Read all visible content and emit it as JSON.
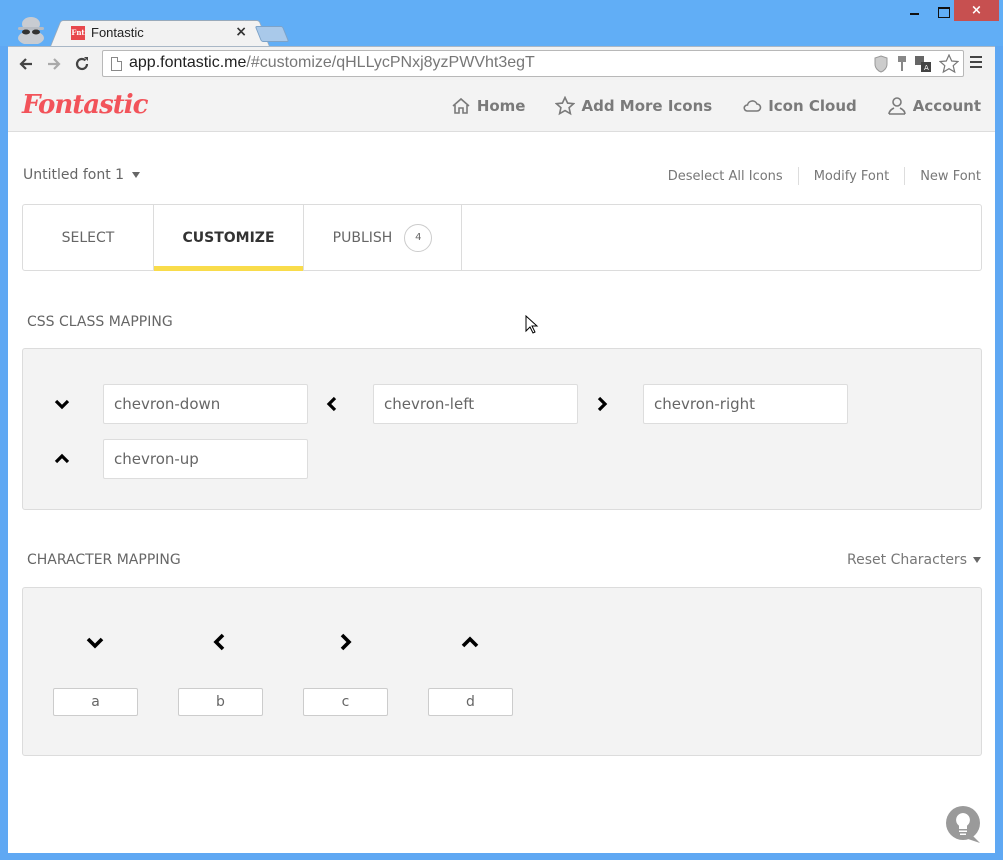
{
  "browser": {
    "tab_title": "Fontastic",
    "tab_favicon_text": "Fnt",
    "url_host": "app.fontastic.me",
    "url_rest": "/#customize/qHLLycPNxj8yzPWVht3egT",
    "close_tab_glyph": "×",
    "window_close_glyph": "×"
  },
  "header": {
    "logo": "Fontastic",
    "nav": [
      {
        "label": "Home",
        "icon": "home-icon"
      },
      {
        "label": "Add More Icons",
        "icon": "star-icon"
      },
      {
        "label": "Icon Cloud",
        "icon": "cloud-icon"
      },
      {
        "label": "Account",
        "icon": "user-icon"
      }
    ]
  },
  "font": {
    "title": "Untitled font 1"
  },
  "actions": {
    "deselect": "Deselect All Icons",
    "modify": "Modify Font",
    "new_font": "New Font"
  },
  "steps": [
    {
      "label": "SELECT",
      "active": false
    },
    {
      "label": "CUSTOMIZE",
      "active": true
    },
    {
      "label": "PUBLISH",
      "active": false,
      "badge": "4"
    }
  ],
  "css_mapping": {
    "title": "CSS CLASS MAPPING",
    "items": [
      {
        "icon": "chevron-down-icon",
        "value": "chevron-down"
      },
      {
        "icon": "chevron-left-icon",
        "value": "chevron-left"
      },
      {
        "icon": "chevron-right-icon",
        "value": "chevron-right"
      },
      {
        "icon": "chevron-up-icon",
        "value": "chevron-up"
      }
    ]
  },
  "char_mapping": {
    "title": "CHARACTER MAPPING",
    "reset_label": "Reset Characters",
    "items": [
      {
        "icon": "chevron-down-icon",
        "char": "a"
      },
      {
        "icon": "chevron-left-icon",
        "char": "b"
      },
      {
        "icon": "chevron-right-icon",
        "char": "c"
      },
      {
        "icon": "chevron-up-icon",
        "char": "d"
      }
    ]
  },
  "colors": {
    "brand": "#f2535a",
    "active_tab_underline": "#f9dc4b",
    "titlebar": "#61aef6",
    "window_close": "#c75050"
  }
}
